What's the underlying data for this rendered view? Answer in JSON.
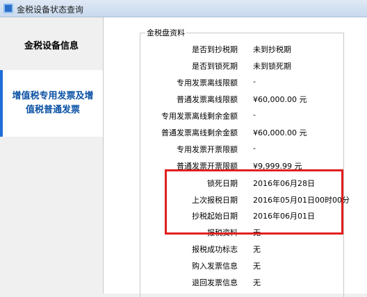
{
  "window": {
    "title": "金税设备状态查询"
  },
  "sidebar": {
    "items": [
      {
        "label": "金税设备信息"
      },
      {
        "label": "增值税专用发票及增值税普通发票"
      }
    ]
  },
  "group": {
    "title": "金税盘资料",
    "rows": [
      {
        "label": "是否到抄税期",
        "value": "未到抄税期"
      },
      {
        "label": "是否到锁死期",
        "value": "未到锁死期"
      },
      {
        "label": "专用发票离线限额",
        "value": "-"
      },
      {
        "label": "普通发票离线限额",
        "value": "¥60,000.00 元"
      },
      {
        "label": "专用发票离线剩余金额",
        "value": "-"
      },
      {
        "label": "普通发票离线剩余金额",
        "value": "¥60,000.00 元"
      },
      {
        "label": "专用发票开票限额",
        "value": "-"
      },
      {
        "label": "普通发票开票限额",
        "value": "¥9,999.99 元"
      },
      {
        "label": "锁死日期",
        "value": "2016年06月28日"
      },
      {
        "label": "上次报税日期",
        "value": "2016年05月01日00时00分"
      },
      {
        "label": "抄税起始日期",
        "value": "2016年06月01日"
      },
      {
        "label": "报税资料",
        "value": "无"
      },
      {
        "label": "报税成功标志",
        "value": "无"
      },
      {
        "label": "购入发票信息",
        "value": "无"
      },
      {
        "label": "退回发票信息",
        "value": "无"
      }
    ]
  },
  "colors": {
    "highlight": "#e21e1e",
    "selected_tab_text": "#0b52a5"
  }
}
